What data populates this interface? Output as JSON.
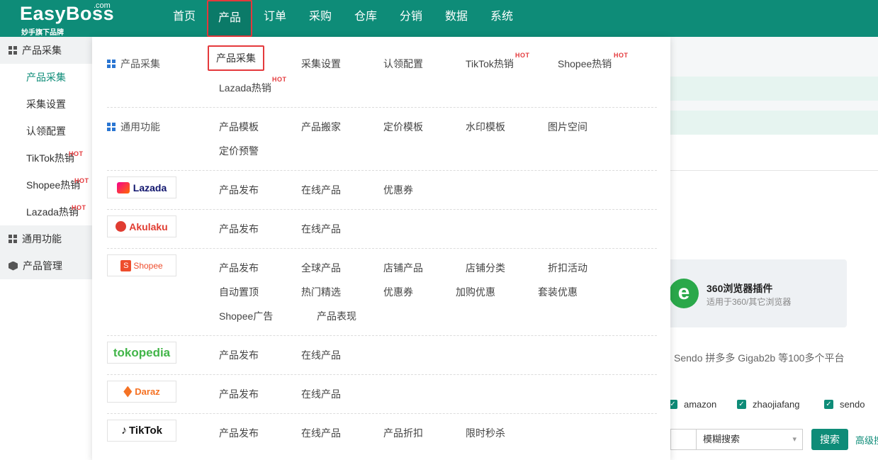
{
  "header": {
    "brand": "EasyBoss",
    "brand_suffix": ".com",
    "brand_sub": "妙手旗下品牌",
    "nav": [
      "首页",
      "产品",
      "订单",
      "采购",
      "仓库",
      "分销",
      "数据",
      "系统"
    ],
    "active_nav": "产品"
  },
  "sidebar": {
    "group1": "产品采集",
    "items": [
      "产品采集",
      "采集设置",
      "认领配置",
      "TikTok热销",
      "Shopee热销",
      "Lazada热销"
    ],
    "hot_badge": "HOT",
    "group2": "通用功能",
    "group3": "产品管理"
  },
  "dropdown": {
    "collect": {
      "label": "产品采集",
      "links": [
        "产品采集",
        "采集设置",
        "认领配置",
        "TikTok热销",
        "Shopee热销",
        "Lazada热销"
      ]
    },
    "general": {
      "label": "通用功能",
      "links": [
        "产品模板",
        "产品搬家",
        "定价模板",
        "水印模板",
        "图片空间",
        "定价预警"
      ]
    },
    "lazada": {
      "logo": "Lazada",
      "links": [
        "产品发布",
        "在线产品",
        "优惠券"
      ]
    },
    "akulaku": {
      "logo": "Akulaku",
      "links": [
        "产品发布",
        "在线产品"
      ]
    },
    "shopee": {
      "logo": "Shopee",
      "links": [
        "产品发布",
        "全球产品",
        "店铺产品",
        "店铺分类",
        "折扣活动",
        "自动置顶",
        "热门精选",
        "优惠券",
        "加购优惠",
        "套装优惠",
        "Shopee广告",
        "产品表现"
      ]
    },
    "tokopedia": {
      "logo": "tokopedia",
      "links": [
        "产品发布",
        "在线产品"
      ]
    },
    "daraz": {
      "logo": "Daraz",
      "links": [
        "产品发布",
        "在线产品"
      ]
    },
    "tiktok": {
      "logo": "TikTok",
      "links": [
        "产品发布",
        "在线产品",
        "产品折扣",
        "限时秒杀"
      ]
    }
  },
  "background": {
    "ext_title": "360浏览器插件",
    "ext_desc": "适用于360/其它浏览器",
    "platforms_text": "Sendo  拼多多  Gigab2b 等100多个平台",
    "checkboxes": [
      "amazon",
      "zhaojiafang",
      "sendo"
    ],
    "search_mode": "模糊搜索",
    "search_button": "搜索",
    "advanced_link": "高级搜"
  },
  "colors": {
    "brand": "#0e8c78",
    "highlight": "#e4393c",
    "hot": "#e4393c"
  }
}
